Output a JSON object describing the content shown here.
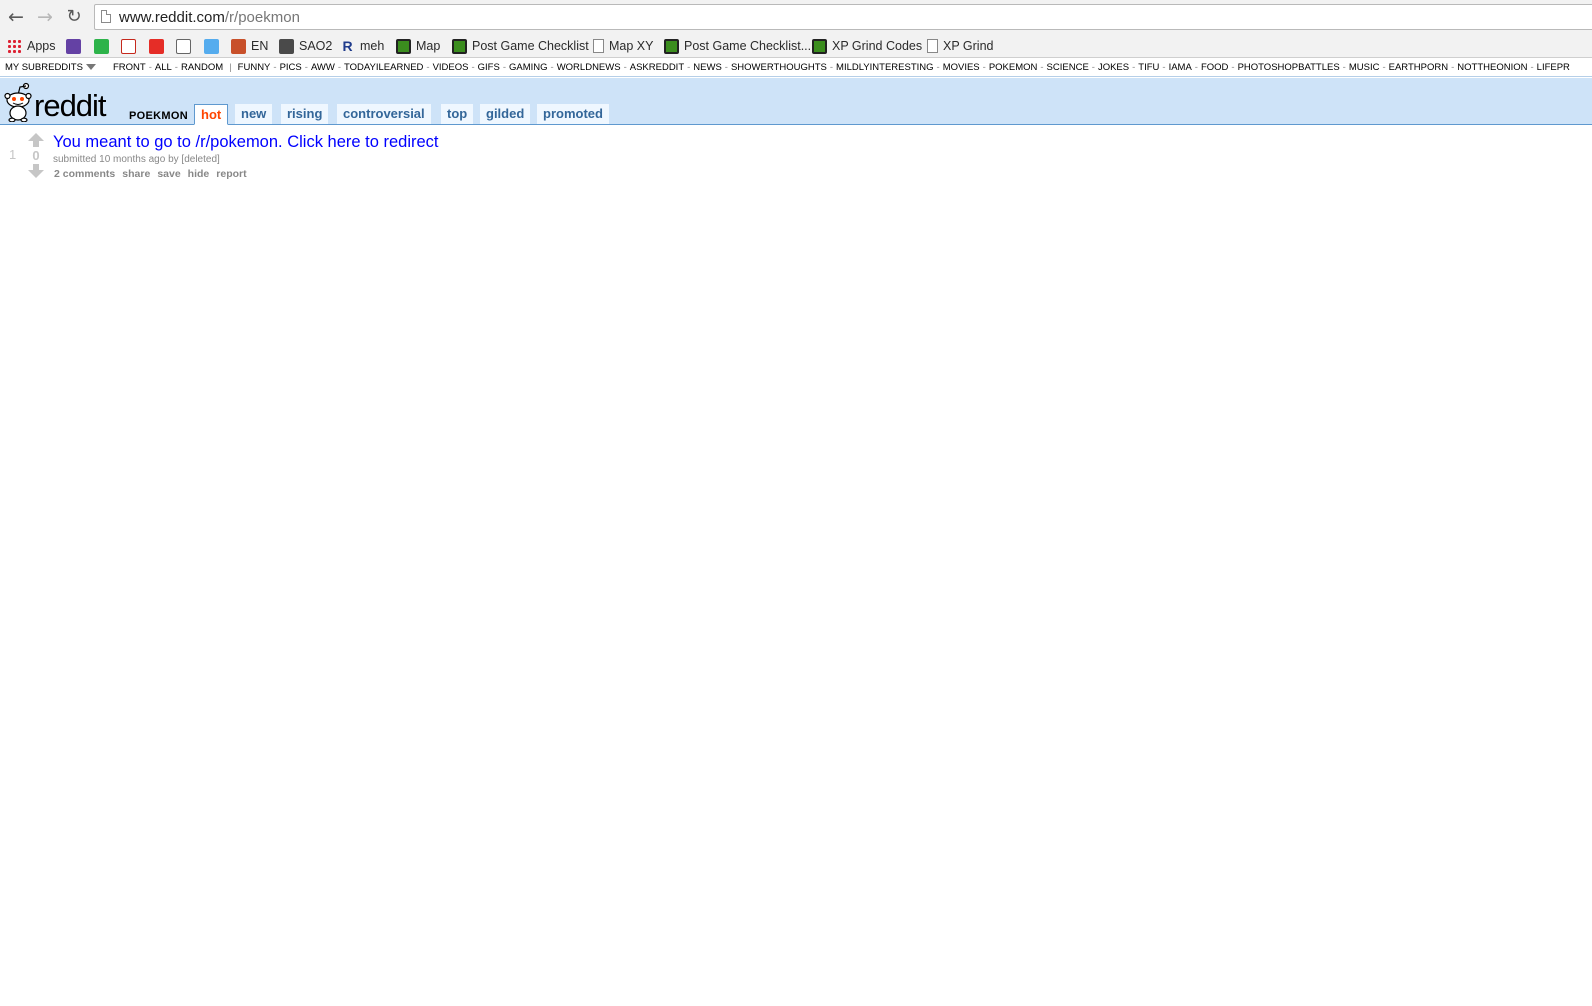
{
  "browser": {
    "url_host": "www.reddit.com",
    "url_path": "/r/poekmon",
    "bookmarks": [
      {
        "label": "Apps",
        "icon": "apps-grid-icon"
      },
      {
        "label": "",
        "icon": "twitch-icon"
      },
      {
        "label": "",
        "icon": "green-app-icon"
      },
      {
        "label": "",
        "icon": "gmail-icon"
      },
      {
        "label": "",
        "icon": "youtube-icon"
      },
      {
        "label": "",
        "icon": "reddit-icon"
      },
      {
        "label": "",
        "icon": "twitter-icon"
      },
      {
        "label": "EN",
        "icon": "orange-site-icon"
      },
      {
        "label": "SAO2",
        "icon": "sao-icon"
      },
      {
        "label": "meh",
        "icon": "r-icon"
      },
      {
        "label": "Map",
        "icon": "globe-icon"
      },
      {
        "label": "Post Game Checklist",
        "icon": "globe-icon"
      },
      {
        "label": "Map XY",
        "icon": "page-icon"
      },
      {
        "label": "Post Game Checklist...",
        "icon": "globe-icon"
      },
      {
        "label": "XP Grind Codes",
        "icon": "globe-icon"
      },
      {
        "label": "XP Grind",
        "icon": "page-icon"
      }
    ]
  },
  "srbar": {
    "my_subreddits": "MY SUBREDDITS",
    "primary": [
      "FRONT",
      "ALL",
      "RANDOM"
    ],
    "subs": [
      "FUNNY",
      "PICS",
      "AWW",
      "TODAYILEARNED",
      "VIDEOS",
      "GIFS",
      "GAMING",
      "WORLDNEWS",
      "ASKREDDIT",
      "NEWS",
      "SHOWERTHOUGHTS",
      "MILDLYINTERESTING",
      "MOVIES",
      "POKEMON",
      "SCIENCE",
      "JOKES",
      "TIFU",
      "IAMA",
      "FOOD",
      "PHOTOSHOPBATTLES",
      "MUSIC",
      "EARTHPORN",
      "NOTTHEONION",
      "LIFEPR"
    ]
  },
  "header": {
    "wordmark": "reddit",
    "subreddit": "POEKMON",
    "tabs": [
      {
        "label": "hot",
        "selected": true
      },
      {
        "label": "new",
        "selected": false
      },
      {
        "label": "rising",
        "selected": false
      },
      {
        "label": "controversial",
        "selected": false
      },
      {
        "label": "top",
        "selected": false
      },
      {
        "label": "gilded",
        "selected": false
      },
      {
        "label": "promoted",
        "selected": false
      }
    ]
  },
  "post": {
    "rank": "1",
    "score": "0",
    "title": "You meant to go to /r/pokemon. Click here to redirect",
    "tagline_prefix": "submitted 10 months ago by ",
    "author": "[deleted]",
    "actions": [
      "2 comments",
      "share",
      "save",
      "hide",
      "report"
    ]
  },
  "colors": {
    "header_bg": "#cee3f8",
    "tab_link": "#336699",
    "tab_selected": "#ff4500",
    "title_link": "#0000ff",
    "muted": "#888888"
  }
}
